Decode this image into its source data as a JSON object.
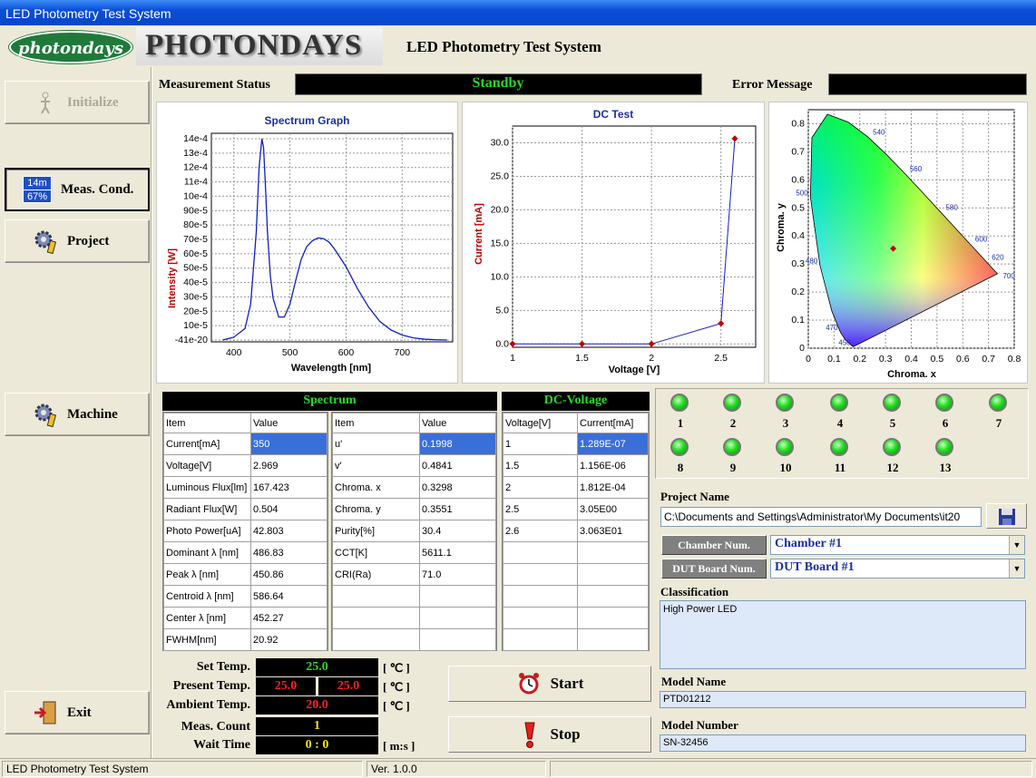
{
  "window": {
    "title": "LED Photometry Test System"
  },
  "header": {
    "logo_badge": "photondays",
    "logo_text": "PHOTONDAYS",
    "app_title": "LED Photometry Test System"
  },
  "sidebar": {
    "initialize": "Initialize",
    "meas_cond": "Meas. Cond.",
    "meas_badge_top": "14m",
    "meas_badge_bottom": "67%",
    "project": "Project",
    "machine": "Machine",
    "exit": "Exit"
  },
  "status": {
    "label": "Measurement Status",
    "value": "Standby",
    "error_label": "Error Message",
    "error_value": ""
  },
  "charts": {
    "spectrum": {
      "title": "Spectrum Graph",
      "xlabel": "Wavelength [nm]",
      "ylabel": "Intensity [W]"
    },
    "dc": {
      "title": "DC Test",
      "xlabel": "Voltage [V]",
      "ylabel": "Current [mA]"
    },
    "cie": {
      "title": "",
      "xlabel": "Chroma. x",
      "ylabel": "Chroma. y"
    }
  },
  "chart_data": [
    {
      "type": "line",
      "title": "Spectrum Graph",
      "xlabel": "Wavelength [nm]",
      "ylabel": "Intensity [W]",
      "xlim": [
        360,
        790
      ],
      "ylim": [
        -4.1e-05,
        0.00145
      ],
      "xticks": [
        400,
        500,
        600,
        700
      ],
      "yticks": [
        "14e-4",
        "13e-4",
        "12e-4",
        "11e-4",
        "10e-4",
        "90e-5",
        "80e-5",
        "70e-5",
        "60e-5",
        "50e-5",
        "40e-5",
        "30e-5",
        "20e-5",
        "10e-5",
        "-41e-20"
      ],
      "x": [
        380,
        400,
        420,
        430,
        440,
        445,
        450,
        453,
        456,
        460,
        465,
        470,
        480,
        490,
        500,
        510,
        520,
        530,
        540,
        550,
        560,
        570,
        580,
        600,
        620,
        640,
        660,
        680,
        700,
        720,
        740,
        760,
        780
      ],
      "y": [
        0,
        2e-05,
        8e-05,
        0.00025,
        0.00075,
        0.0012,
        0.0014,
        0.00134,
        0.0011,
        0.00075,
        0.00045,
        0.00029,
        0.00016,
        0.00016,
        0.00025,
        0.00041,
        0.00056,
        0.00065,
        0.00069,
        0.00071,
        0.000705,
        0.00068,
        0.00063,
        0.00051,
        0.00036,
        0.00023,
        0.00013,
        7e-05,
        3.5e-05,
        1.5e-05,
        6e-06,
        2e-06,
        0
      ]
    },
    {
      "type": "line",
      "title": "DC Test",
      "xlabel": "Voltage [V]",
      "ylabel": "Current [mA]",
      "xlim": [
        1,
        2.75
      ],
      "ylim": [
        -0.5,
        32.5
      ],
      "xticks": [
        "1",
        "1.5",
        "2",
        "2.5"
      ],
      "yticks": [
        "0.0",
        "5.0",
        "10.0",
        "15.0",
        "20.0",
        "25.0",
        "30.0"
      ],
      "x": [
        1,
        1.5,
        2,
        2.5,
        2.6
      ],
      "y": [
        0,
        0,
        0,
        3.05,
        30.63
      ]
    },
    {
      "type": "scatter",
      "title": "",
      "xlabel": "Chroma. x",
      "ylabel": "Chroma. y",
      "xlim": [
        0,
        0.8
      ],
      "ylim": [
        0,
        0.85
      ],
      "xticks": [
        "0",
        "0.1",
        "0.2",
        "0.3",
        "0.4",
        "0.5",
        "0.6",
        "0.7",
        "0.8"
      ],
      "yticks": [
        "0",
        "0.1",
        "0.2",
        "0.3",
        "0.4",
        "0.5",
        "0.6",
        "0.7",
        "0.8"
      ],
      "wavelength_labels": [
        "540",
        "560",
        "580",
        "600",
        "620",
        "700",
        "500",
        "480",
        "470",
        "450"
      ],
      "point": {
        "x": 0.3298,
        "y": 0.3551
      }
    }
  ],
  "spectrum_table": {
    "title": "Spectrum",
    "headers": [
      "Item",
      "Value",
      "Item",
      "Value"
    ],
    "left": [
      [
        "Current[mA]",
        "350"
      ],
      [
        "Voltage[V]",
        "2.969"
      ],
      [
        "Luminous Flux[lm]",
        "167.423"
      ],
      [
        "Radiant Flux[W]",
        "0.504"
      ],
      [
        "Photo Power[uA]",
        "42.803"
      ],
      [
        "Dominant λ [nm]",
        "486.83"
      ],
      [
        "Peak λ [nm]",
        "450.86"
      ],
      [
        "Centroid λ [nm]",
        "586.64"
      ],
      [
        "Center λ [nm]",
        "452.27"
      ],
      [
        "FWHM[nm]",
        "20.92"
      ]
    ],
    "right": [
      [
        "u'",
        "0.1998"
      ],
      [
        "v'",
        "0.4841"
      ],
      [
        "Chroma. x",
        "0.3298"
      ],
      [
        "Chroma. y",
        "0.3551"
      ],
      [
        "Purity[%]",
        "30.4"
      ],
      [
        "CCT[K]",
        "5611.1"
      ],
      [
        "CRI(Ra)",
        "71.0"
      ],
      [
        "",
        ""
      ],
      [
        "",
        ""
      ],
      [
        "",
        ""
      ]
    ]
  },
  "dc_table": {
    "title": "DC-Voltage",
    "headers": [
      "Voltage[V]",
      "Current[mA]"
    ],
    "rows": [
      [
        "1",
        "1.289E-07"
      ],
      [
        "1.5",
        "1.156E-06"
      ],
      [
        "2",
        "1.812E-04"
      ],
      [
        "2.5",
        "3.05E00"
      ],
      [
        "2.6",
        "3.063E01"
      ],
      [
        "",
        ""
      ],
      [
        "",
        ""
      ],
      [
        "",
        ""
      ],
      [
        "",
        ""
      ],
      [
        "",
        ""
      ]
    ]
  },
  "leds": [
    "1",
    "2",
    "3",
    "4",
    "5",
    "6",
    "7",
    "8",
    "9",
    "10",
    "11",
    "12",
    "13"
  ],
  "project": {
    "label": "Project Name",
    "path": "C:\\Documents and Settings\\Administrator\\My Documents\\it20",
    "chamber_label": "Chamber Num.",
    "chamber_value": "Chamber #1",
    "dut_label": "DUT Board Num.",
    "dut_value": "DUT Board #1",
    "classification_label": "Classification",
    "classification_value": "High Power LED",
    "model_name_label": "Model Name",
    "model_name_value": "PTD01212",
    "model_number_label": "Model Number",
    "model_number_value": "SN-32456"
  },
  "temps": {
    "set_label": "Set Temp.",
    "set_value": "25.0",
    "present_label": "Present Temp.",
    "present_value1": "25.0",
    "present_value2": "25.0",
    "ambient_label": "Ambient Temp.",
    "ambient_value": "20.0",
    "count_label": "Meas. Count",
    "count_value": "1",
    "wait_label": "Wait Time",
    "wait_value": "0 : 0",
    "unit_c": "[ ℃ ]",
    "unit_ms": "[ m:s ]"
  },
  "actions": {
    "start": "Start",
    "stop": "Stop"
  },
  "statusbar": {
    "app": "LED Photometry Test System",
    "version": "Ver. 1.0.0"
  },
  "colors": {
    "status_green": "#22dd22",
    "chart_title": "#1a2fa8",
    "axis_label_red": "#c00000",
    "selected": "#3a6fd8"
  }
}
